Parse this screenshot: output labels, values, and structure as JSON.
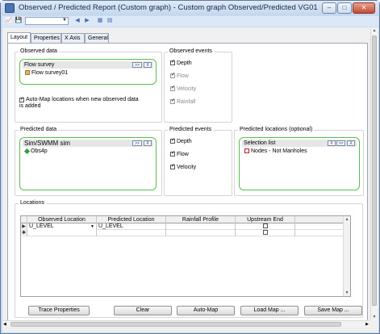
{
  "window": {
    "title": "Observed / Predicted Report (Custom graph) - Custom graph Observed/Predicted VG01",
    "controls": {
      "minimize": "–",
      "maximize": "□",
      "close": "✕"
    }
  },
  "toolbar": {
    "icons": [
      "graph-icon",
      "save-icon",
      "back-icon",
      "forward-icon",
      "grid-view-icon",
      "list-view-icon"
    ]
  },
  "tabs": [
    "Layout",
    "Properties",
    "X Axis",
    "General"
  ],
  "observed_data": {
    "label": "Observed data",
    "box_title": "Flow survey",
    "btn_next": ">>",
    "btn_clear": "X",
    "item": "Flow survey01"
  },
  "automap": {
    "label": "Auto-Map locations when new observed data is added",
    "checked": true
  },
  "observed_events": {
    "label": "Observed events",
    "items": [
      {
        "label": "Depth",
        "checked": true,
        "enabled": true
      },
      {
        "label": "Flow",
        "checked": true,
        "enabled": false
      },
      {
        "label": "Velocity",
        "checked": true,
        "enabled": false
      },
      {
        "label": "Rainfall",
        "checked": true,
        "enabled": false
      }
    ]
  },
  "predicted_data": {
    "label": "Predicted data",
    "box_title": "Sim/SWMM sim",
    "btn_next": ">>",
    "btn_clear": "X",
    "item": "Obs4p"
  },
  "predicted_events": {
    "label": "Predicted events",
    "items": [
      {
        "label": "Depth",
        "checked": true
      },
      {
        "label": "Flow",
        "checked": true
      },
      {
        "label": "Velocity",
        "checked": true
      }
    ]
  },
  "predicted_locations": {
    "label": "Predicted locations (optional)",
    "box_title": "Selection list",
    "btn_hash": "#",
    "btn_next": ">>",
    "btn_clear": "X",
    "item": "Nodes - Not Manholes"
  },
  "locations": {
    "label": "Locations",
    "columns": [
      "Observed Location",
      "Predicted Location",
      "Rainfall Profile",
      "Upstream End"
    ],
    "rows": [
      {
        "marker": "▶",
        "observed": "U_LEVEL",
        "predicted": "U_LEVEL",
        "rainfall": "",
        "upstream": false
      },
      {
        "marker": "✱",
        "observed": "",
        "predicted": "",
        "rainfall": "",
        "upstream": false
      }
    ]
  },
  "buttons": {
    "trace": "Trace Properties",
    "clear": "Clear",
    "automap": "Auto-Map",
    "load": "Load Map ...",
    "save": "Save Map ..."
  },
  "colors": {
    "group_outline": "#53c24b",
    "titlebar": "#c9dbf0"
  }
}
